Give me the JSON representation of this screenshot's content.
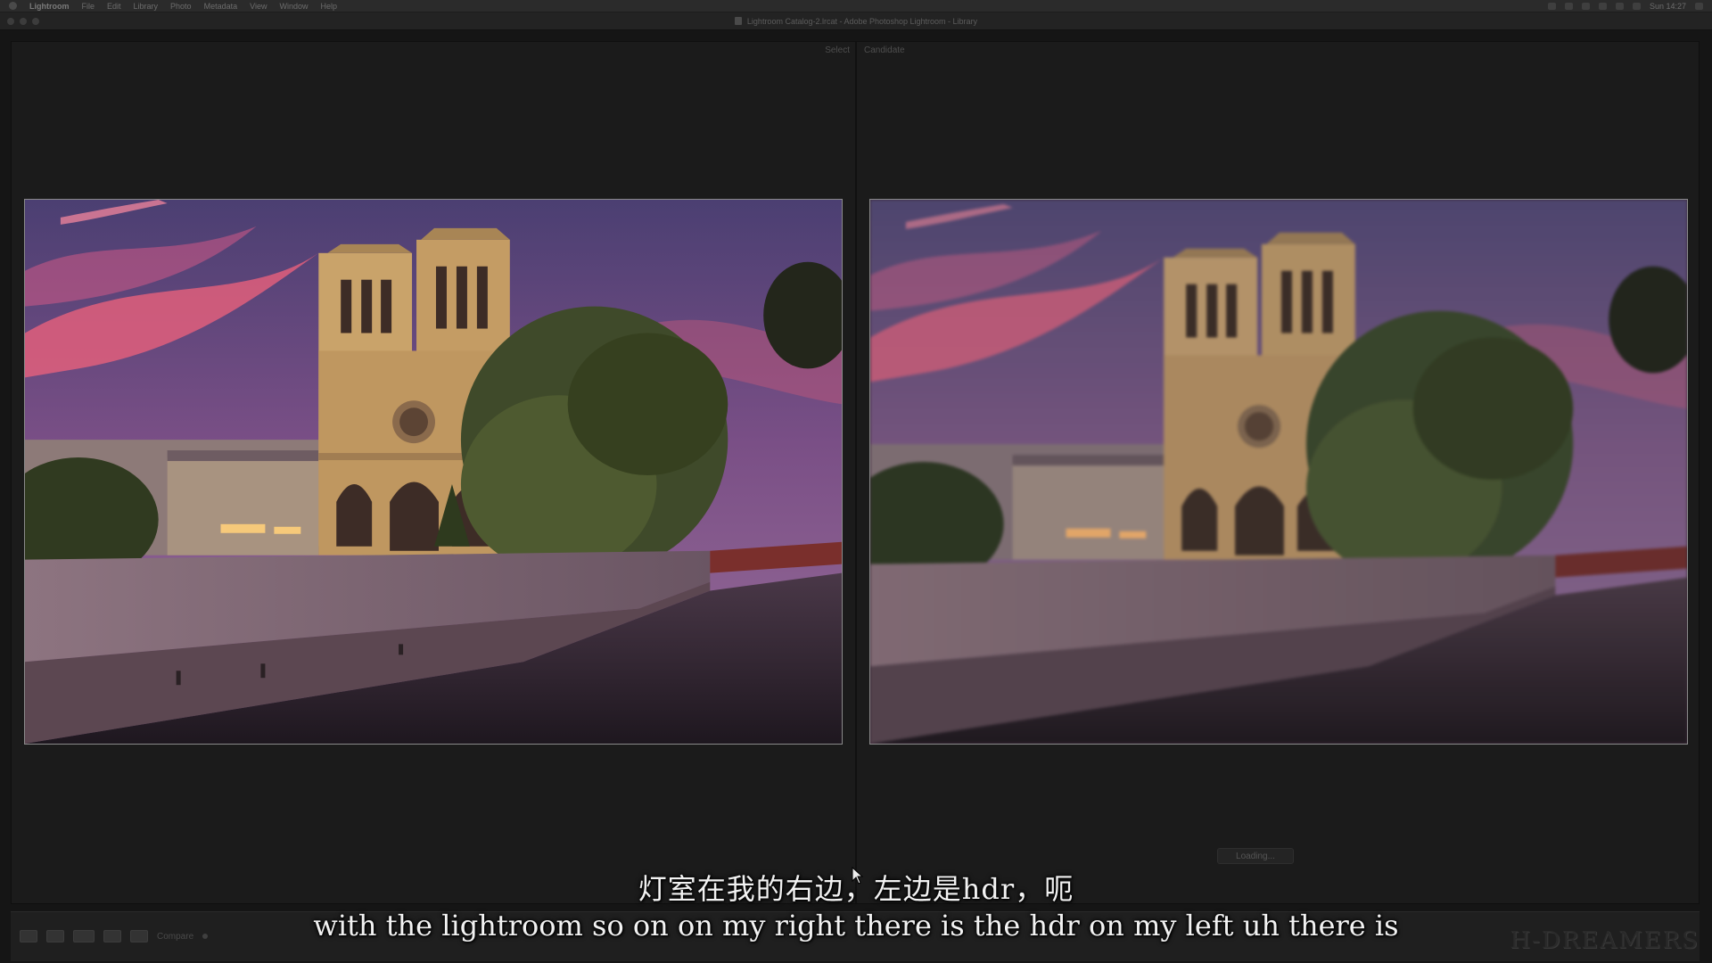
{
  "menubar": {
    "app_name": "Lightroom",
    "items": [
      "File",
      "Edit",
      "Library",
      "Photo",
      "Metadata",
      "View",
      "Window",
      "Help"
    ],
    "clock": "Sun 14:27"
  },
  "window": {
    "title": "Lightroom Catalog-2.lrcat - Adobe Photoshop Lightroom - Library"
  },
  "compare": {
    "left_label": "Select",
    "right_label": "Candidate",
    "loading_text": "Loading..."
  },
  "toolbar": {
    "compare_text": "Compare"
  },
  "subtitles": {
    "chinese": "灯室在我的右边，左边是hdr，呃",
    "english": "with the lightroom so on on my right there is the hdr on my left uh there is"
  },
  "watermark": "H-DREAMERS",
  "colors": {
    "background": "#151515",
    "panel": "#1b1b1b",
    "sky_top": "#4a3a6e",
    "sky_glow": "#e0607a",
    "cathedral": "#c9a36a"
  }
}
